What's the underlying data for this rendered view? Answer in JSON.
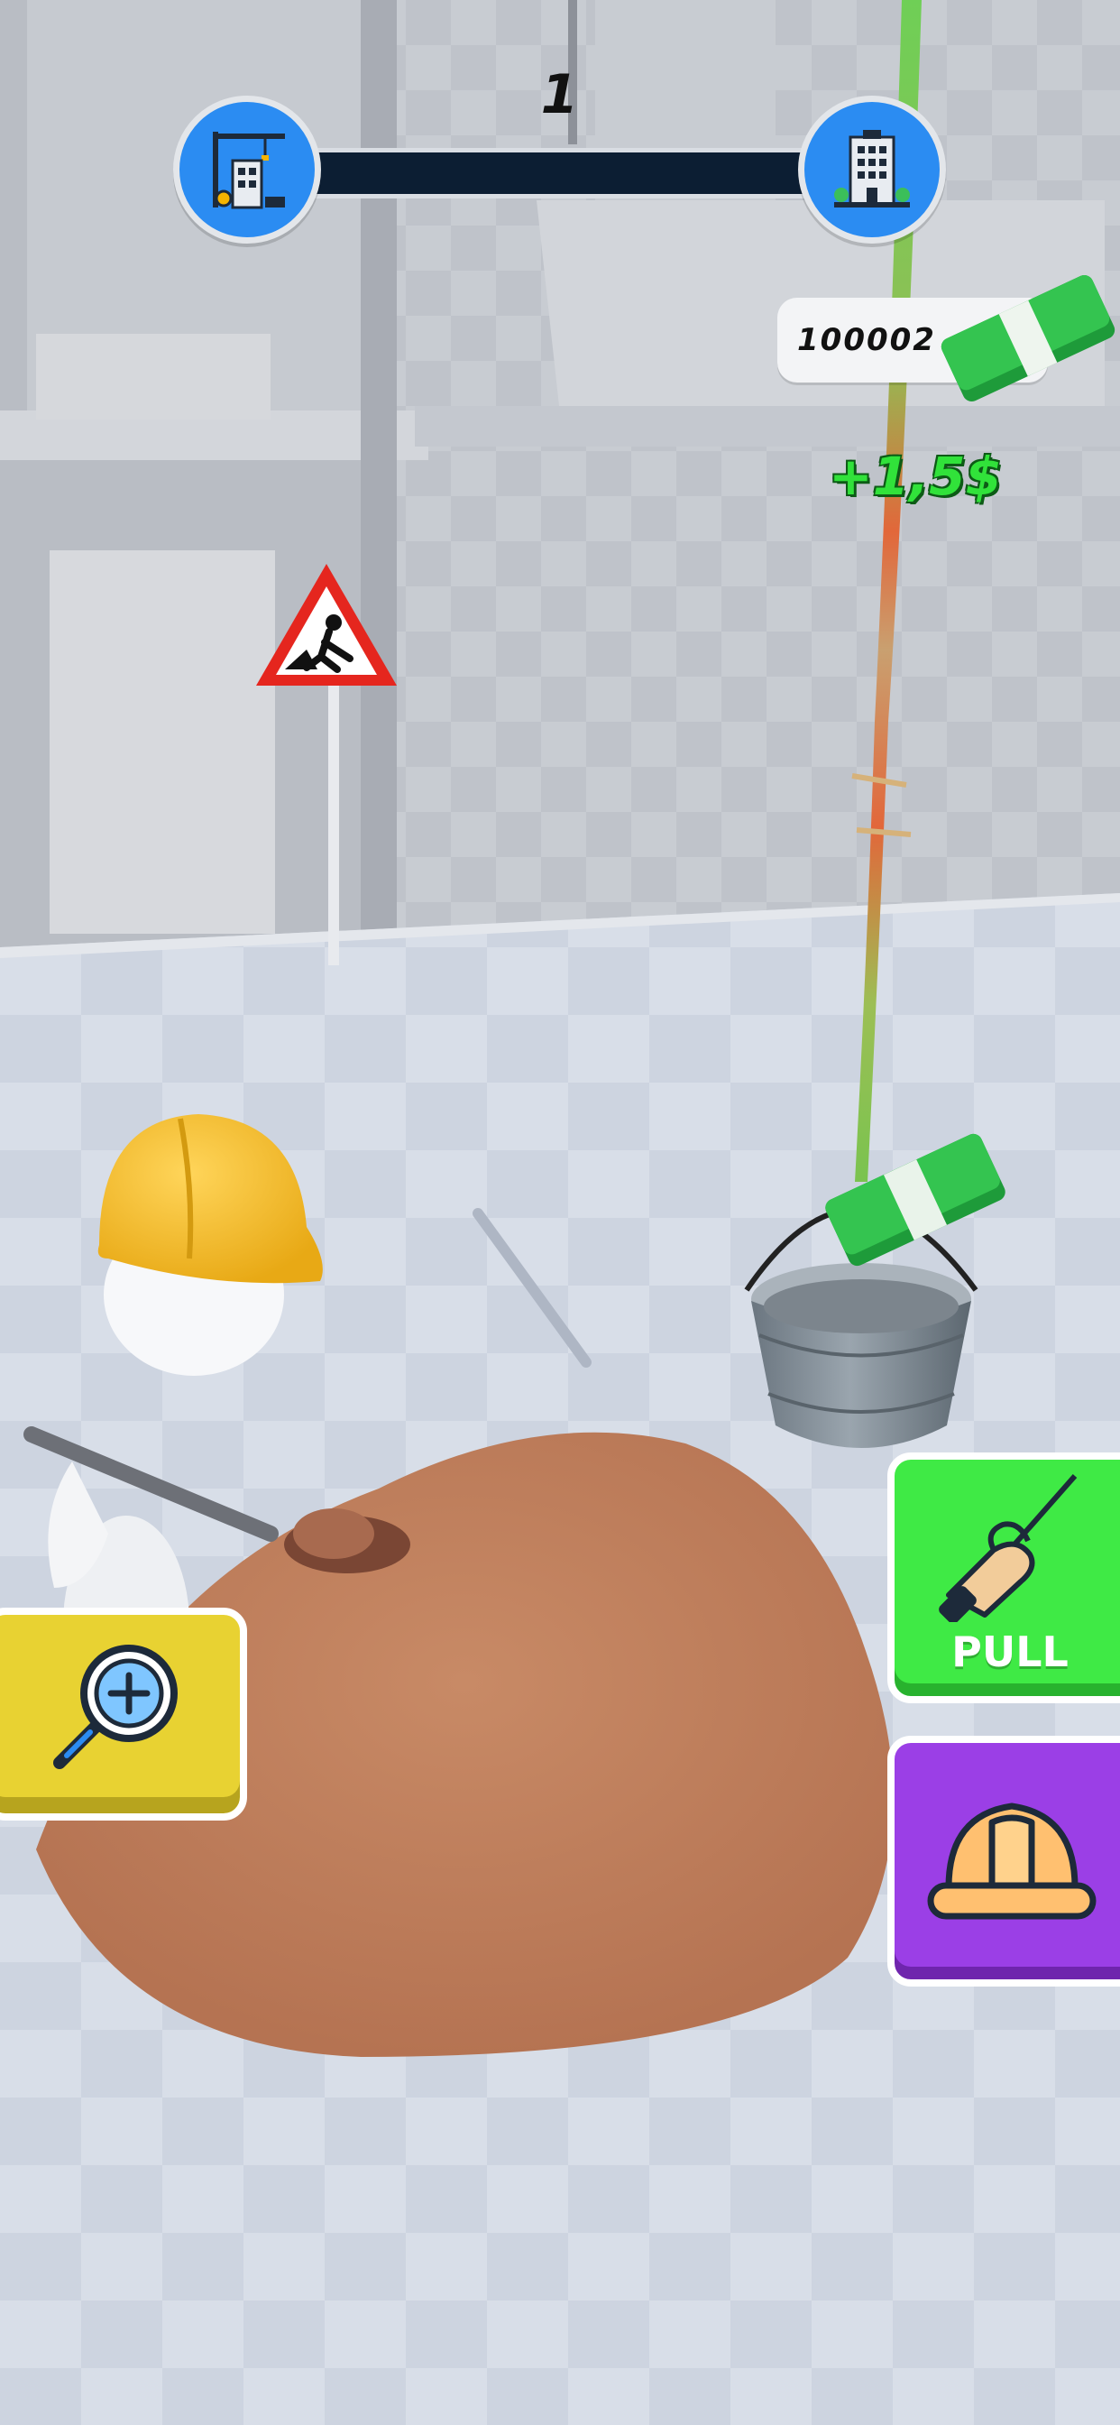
{
  "hud": {
    "level_number": "1",
    "progress_fraction": 0.0,
    "start_stage_icon": "construction-site-icon",
    "end_stage_icon": "finished-building-icon"
  },
  "wallet": {
    "money": "100002",
    "icon": "cash-stack-icon"
  },
  "income_popup": "+1,5$",
  "buttons": {
    "zoom": {
      "icon": "magnifier-plus-icon"
    },
    "pull": {
      "label": "PULL",
      "icon": "hand-pulling-rope-icon"
    },
    "helmet": {
      "icon": "hard-hat-icon"
    }
  },
  "colors": {
    "badge_blue": "#2b8cf2",
    "pull_green": "#3fea45",
    "zoom_yellow": "#e8d232",
    "helmet_purple": "#9b3fe6",
    "income_green": "#31e23a"
  }
}
